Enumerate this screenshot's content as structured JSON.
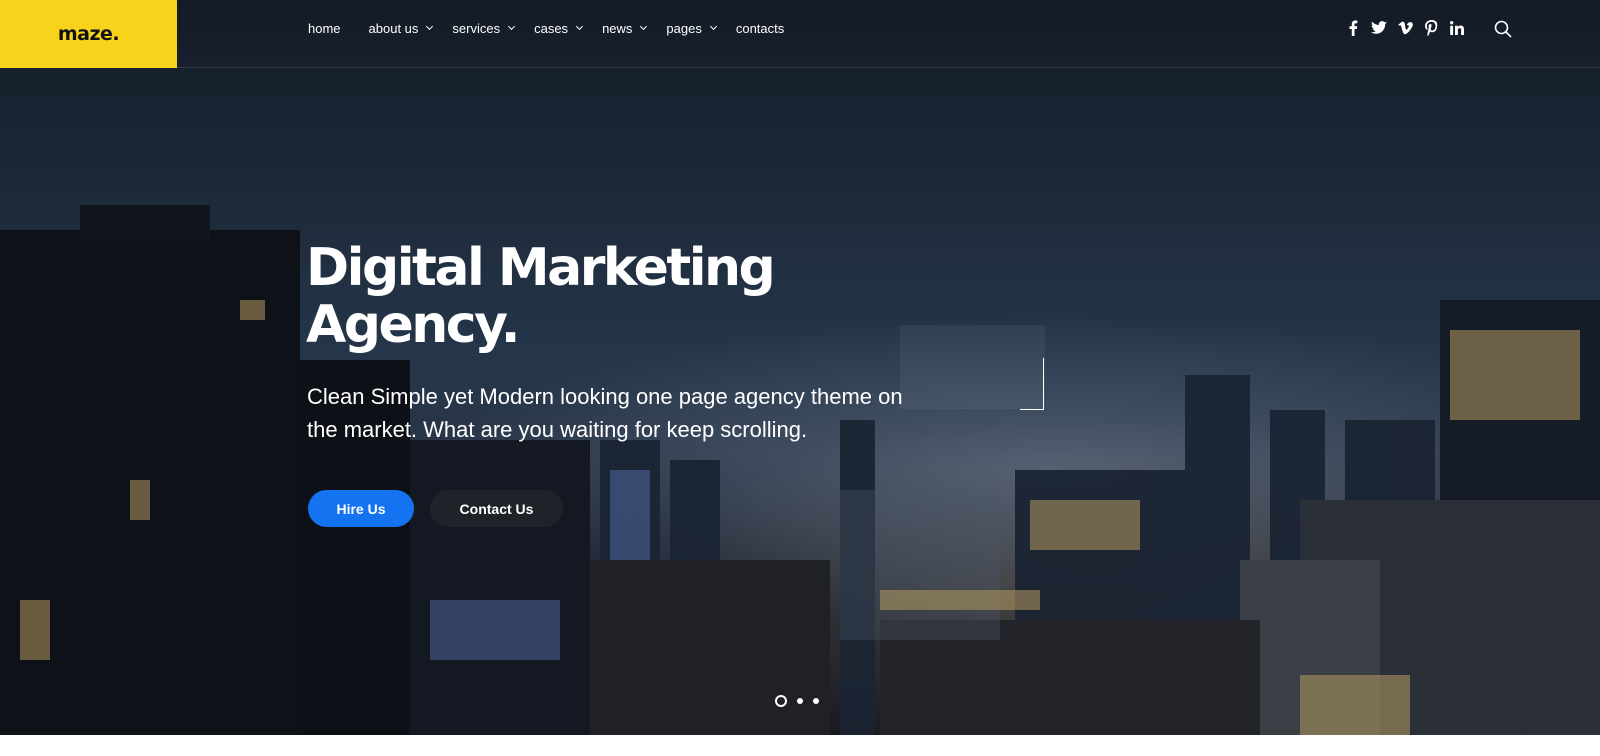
{
  "brand": {
    "logo_text": "maze.",
    "accent_color": "#f7d31c"
  },
  "nav": {
    "items": [
      {
        "label": "home",
        "has_dropdown": false
      },
      {
        "label": "about us",
        "has_dropdown": true
      },
      {
        "label": "services",
        "has_dropdown": true
      },
      {
        "label": "cases",
        "has_dropdown": true
      },
      {
        "label": "news",
        "has_dropdown": true
      },
      {
        "label": "pages",
        "has_dropdown": true
      },
      {
        "label": "contacts",
        "has_dropdown": false
      }
    ]
  },
  "social": {
    "icons": [
      "facebook-icon",
      "twitter-icon",
      "vimeo-icon",
      "pinterest-icon",
      "linkedin-icon"
    ],
    "search_icon": "search-icon"
  },
  "hero": {
    "headline_line1": "Digital Marketing",
    "headline_line2": "Agency.",
    "subtext_line1": "Clean Simple yet Modern looking one page agency theme on",
    "subtext_line2": "the market. What are you waiting for keep scrolling.",
    "primary_button": "Hire Us",
    "secondary_button": "Contact Us",
    "primary_color": "#1473f0",
    "secondary_color": "#1f2329"
  },
  "slider": {
    "total_slides": 3,
    "active_index": 0
  }
}
